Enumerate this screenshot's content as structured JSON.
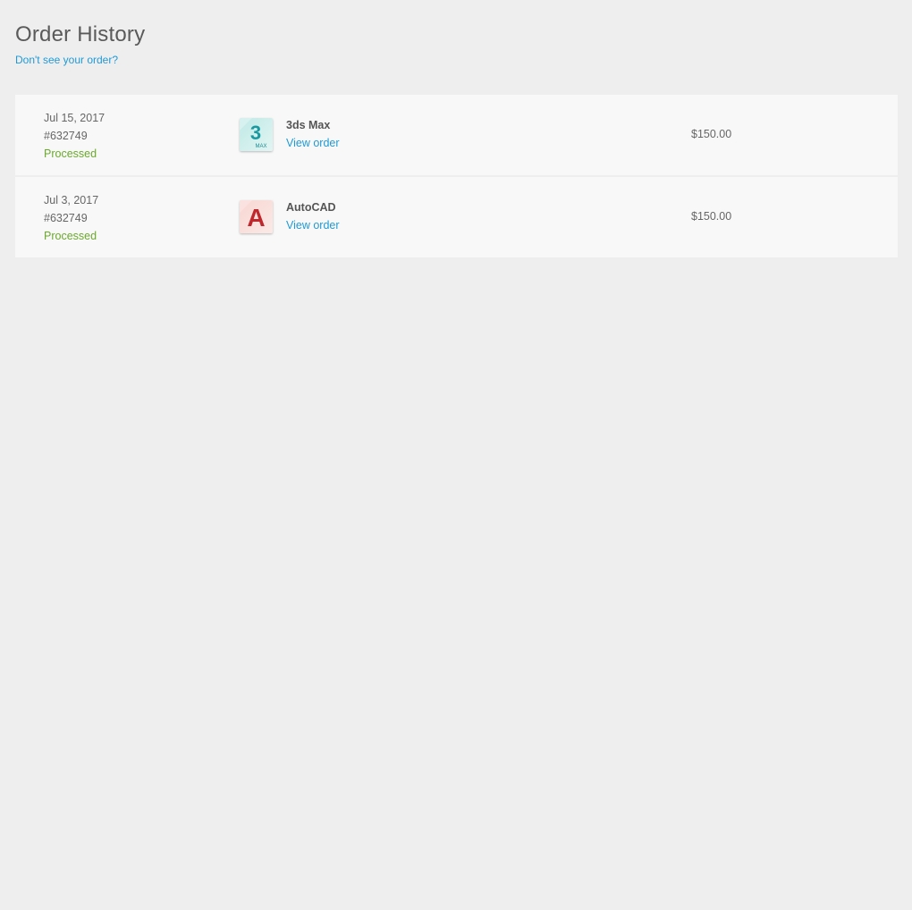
{
  "page": {
    "title": "Order History",
    "help_link": "Don't see your order?"
  },
  "orders": [
    {
      "date": "Jul 15, 2017",
      "number": "#632749",
      "status": "Processed",
      "product": "3ds Max",
      "view_label": "View order",
      "price": "$150.00",
      "icon": "3ds-max-logo-icon",
      "icon_glyph": "3",
      "icon_subtext": "MAX"
    },
    {
      "date": "Jul 3, 2017",
      "number": "#632749",
      "status": "Processed",
      "product": "AutoCAD",
      "view_label": "View order",
      "price": "$150.00",
      "icon": "autocad-logo-icon",
      "icon_glyph": "A"
    }
  ],
  "colors": {
    "background": "#eeeeee",
    "row_background": "#f8f8f8",
    "link": "#1f9ad6",
    "status_processed": "#6aaa2a",
    "text": "#555555"
  }
}
